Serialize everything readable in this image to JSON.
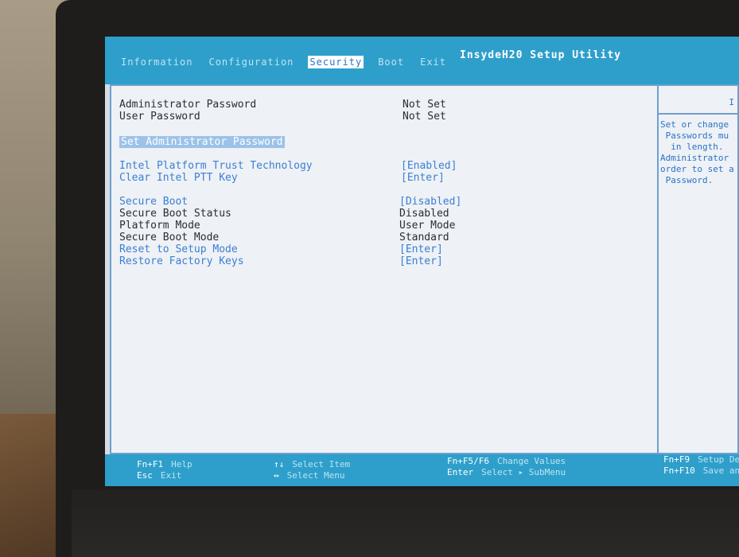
{
  "title": "InsydeH20 Setup Utility",
  "tabs": [
    {
      "label": "Information"
    },
    {
      "label": "Configuration"
    },
    {
      "label": "Security"
    },
    {
      "label": "Boot"
    },
    {
      "label": "Exit"
    }
  ],
  "items": [
    {
      "label": "Administrator Password",
      "value": "Not Set"
    },
    {
      "label": "User Password",
      "value": "Not Set"
    },
    {
      "label": "Set Administrator Password",
      "value": ""
    },
    {
      "label": "Intel Platform Trust Technology",
      "value": "[Enabled]"
    },
    {
      "label": "Clear Intel PTT Key",
      "value": "[Enter]"
    },
    {
      "label": "Secure Boot",
      "value": "[Disabled]"
    },
    {
      "label": "Secure Boot Status",
      "value": "Disabled"
    },
    {
      "label": "Platform Mode",
      "value": "User Mode"
    },
    {
      "label": "Secure Boot Mode",
      "value": "Standard"
    },
    {
      "label": "Reset to Setup Mode",
      "value": "[Enter]"
    },
    {
      "label": "Restore Factory Keys",
      "value": "[Enter]"
    }
  ],
  "help": {
    "header": "I",
    "text": "Set or change\n Passwords mu\n  in length.\nAdministrator\norder to set a\n Password."
  },
  "footer": [
    {
      "key": "Fn+F1",
      "action": "Help"
    },
    {
      "key": "Esc",
      "action": "Exit"
    },
    {
      "key": "↑↓",
      "action": "Select Item"
    },
    {
      "key": "↔",
      "action": "Select Menu"
    },
    {
      "key": "Fn+F5/F6",
      "action": "Change Values"
    },
    {
      "key": "Enter",
      "action": "Select ▸ SubMenu"
    },
    {
      "key": "Fn+F9",
      "action": "Setup De"
    },
    {
      "key": "Fn+F10",
      "action": "Save and"
    }
  ],
  "colors": {
    "accent": "#2e9fcb",
    "link": "#3a7fd4",
    "background": "#eef1f5"
  }
}
